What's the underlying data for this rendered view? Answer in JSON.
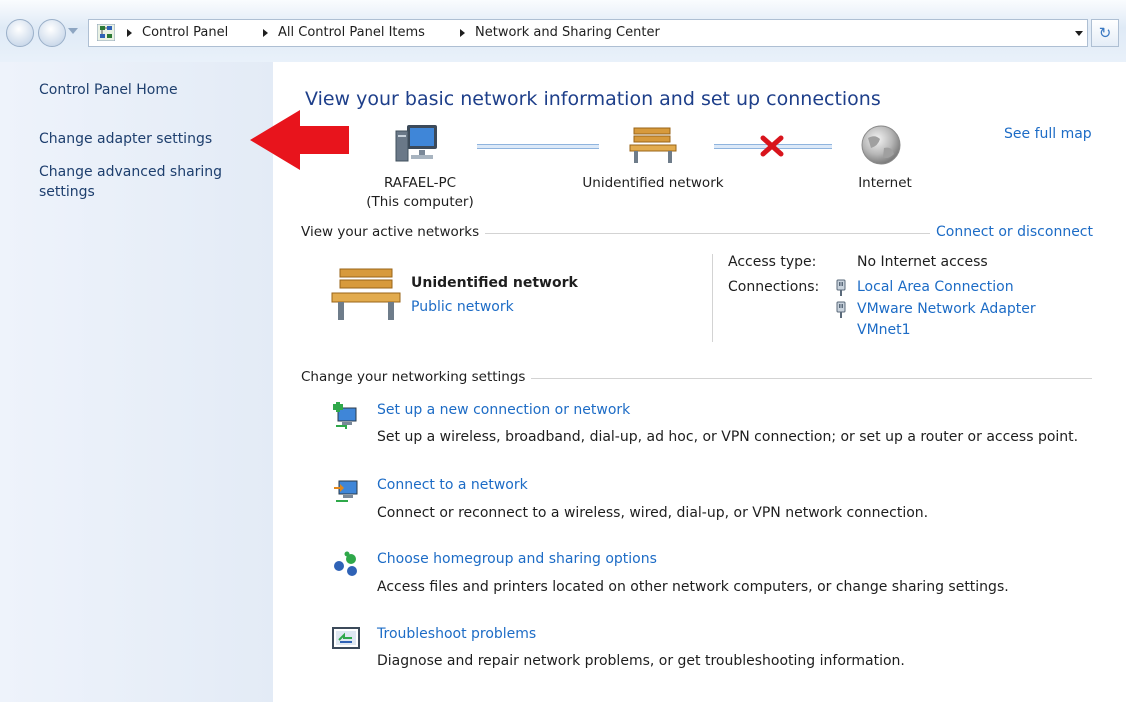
{
  "breadcrumb": {
    "items": [
      "Control Panel",
      "All Control Panel Items",
      "Network and Sharing Center"
    ]
  },
  "sidebar": {
    "items": [
      {
        "label": "Control Panel Home"
      },
      {
        "label": "Change adapter settings"
      },
      {
        "label": "Change advanced sharing settings"
      }
    ]
  },
  "main": {
    "title": "View your basic network information and set up connections",
    "see_full_map": "See full map",
    "map": {
      "computer_name": "RAFAEL-PC",
      "computer_sub": "(This computer)",
      "network_label": "Unidentified network",
      "internet_label": "Internet"
    },
    "active_networks": {
      "header": "View your active networks",
      "connect_link": "Connect or disconnect",
      "network_name": "Unidentified network",
      "network_type": "Public network",
      "access_type_label": "Access type:",
      "access_type_value": "No Internet access",
      "connections_label": "Connections:",
      "connections": [
        "Local Area Connection",
        "VMware Network Adapter",
        "VMnet1"
      ]
    },
    "settings": {
      "header": "Change your networking settings",
      "tasks": [
        {
          "title": "Set up a new connection or network",
          "desc": "Set up a wireless, broadband, dial-up, ad hoc, or VPN connection; or set up a router or access point."
        },
        {
          "title": "Connect to a network",
          "desc": "Connect or reconnect to a wireless, wired, dial-up, or VPN network connection."
        },
        {
          "title": "Choose homegroup and sharing options",
          "desc": "Access files and printers located on other network computers, or change sharing settings."
        },
        {
          "title": "Troubleshoot problems",
          "desc": "Diagnose and repair network problems, or get troubleshooting information."
        }
      ]
    }
  },
  "colors": {
    "link": "#1d6cc6",
    "title": "#1e3f8a",
    "annotation_arrow": "#e8141c",
    "error_x": "#d8141c"
  }
}
